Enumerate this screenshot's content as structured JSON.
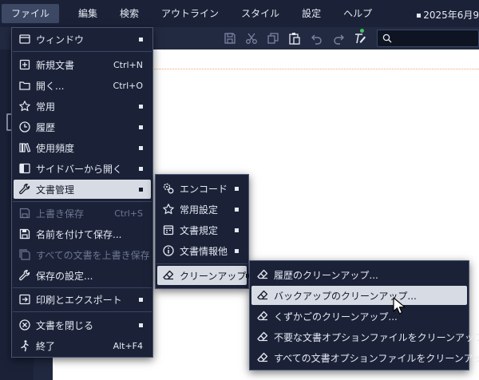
{
  "menubar": {
    "items": [
      "ファイル",
      "編集",
      "検索",
      "アウトライン",
      "スタイル",
      "設定",
      "ヘルプ"
    ],
    "date": "2025年6月9"
  },
  "search": {
    "value": ""
  },
  "file_menu": {
    "window": "ウィンドウ",
    "new_doc": "新規文書",
    "new_doc_shortcut": "Ctrl+N",
    "open": "開く...",
    "open_shortcut": "Ctrl+O",
    "favorites": "常用",
    "history": "履歴",
    "frequency": "使用頻度",
    "open_sidebar": "サイドバーから開く",
    "doc_manage": "文書管理",
    "save": "上書き保存",
    "save_shortcut": "Ctrl+S",
    "save_as": "名前を付けて保存...",
    "save_all": "すべての文書を上書き保存",
    "save_settings": "保存の設定...",
    "print_export": "印刷とエクスポート",
    "close_doc": "文書を閉じる",
    "quit": "終了",
    "quit_shortcut": "Alt+F4"
  },
  "doc_menu": {
    "encode": "エンコード",
    "favorite_settings": "常用設定",
    "doc_rules": "文書規定",
    "doc_info": "文書情報他",
    "cleanup": "クリーンアップ"
  },
  "cleanup_menu": {
    "history": "履歴のクリーンアップ...",
    "backup": "バックアップのクリーンアップ...",
    "trash": "くずかごのクリーンアップ...",
    "unneeded_options": "不要な文書オプションファイルをクリーンアップ...",
    "all_options": "すべての文書オプションファイルをクリーンアップ..."
  },
  "colors": {
    "menu_bg": "#1b2238",
    "highlight": "#d7dbe4",
    "accent_dot": "#42c35a"
  }
}
